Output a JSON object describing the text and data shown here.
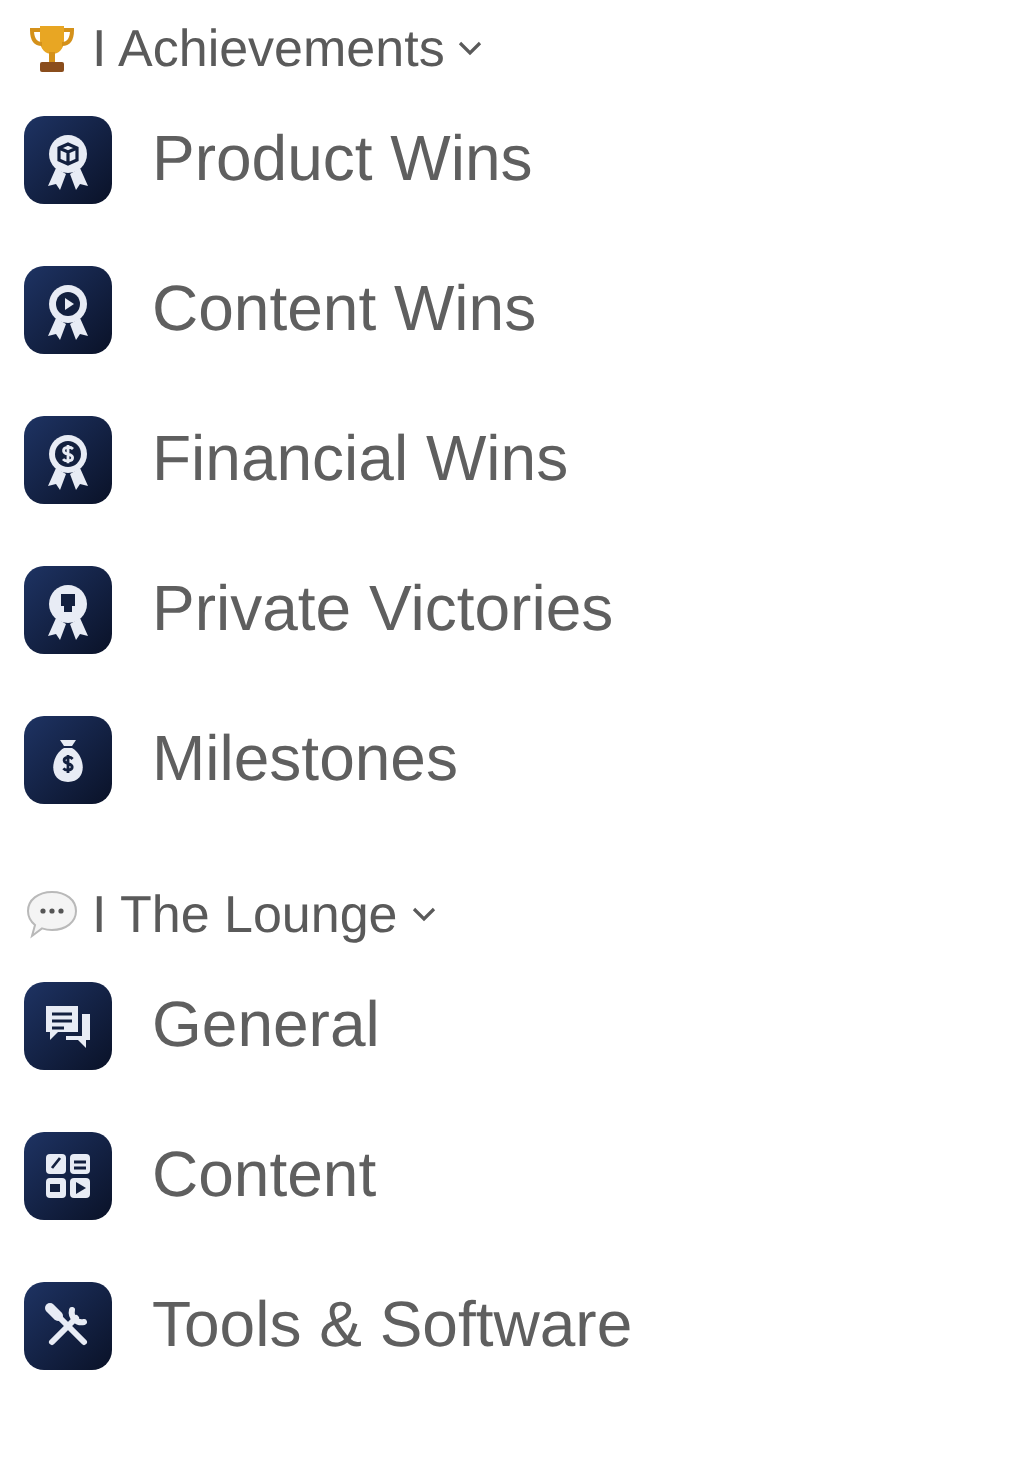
{
  "sections": [
    {
      "title": "I Achievements",
      "expanded": true,
      "items": [
        {
          "label": "Product Wins"
        },
        {
          "label": "Content Wins"
        },
        {
          "label": "Financial Wins"
        },
        {
          "label": "Private Victories"
        },
        {
          "label": "Milestones"
        }
      ]
    },
    {
      "title": "I The Lounge",
      "expanded": true,
      "items": [
        {
          "label": "General"
        },
        {
          "label": "Content"
        },
        {
          "label": "Tools & Software"
        }
      ]
    }
  ]
}
